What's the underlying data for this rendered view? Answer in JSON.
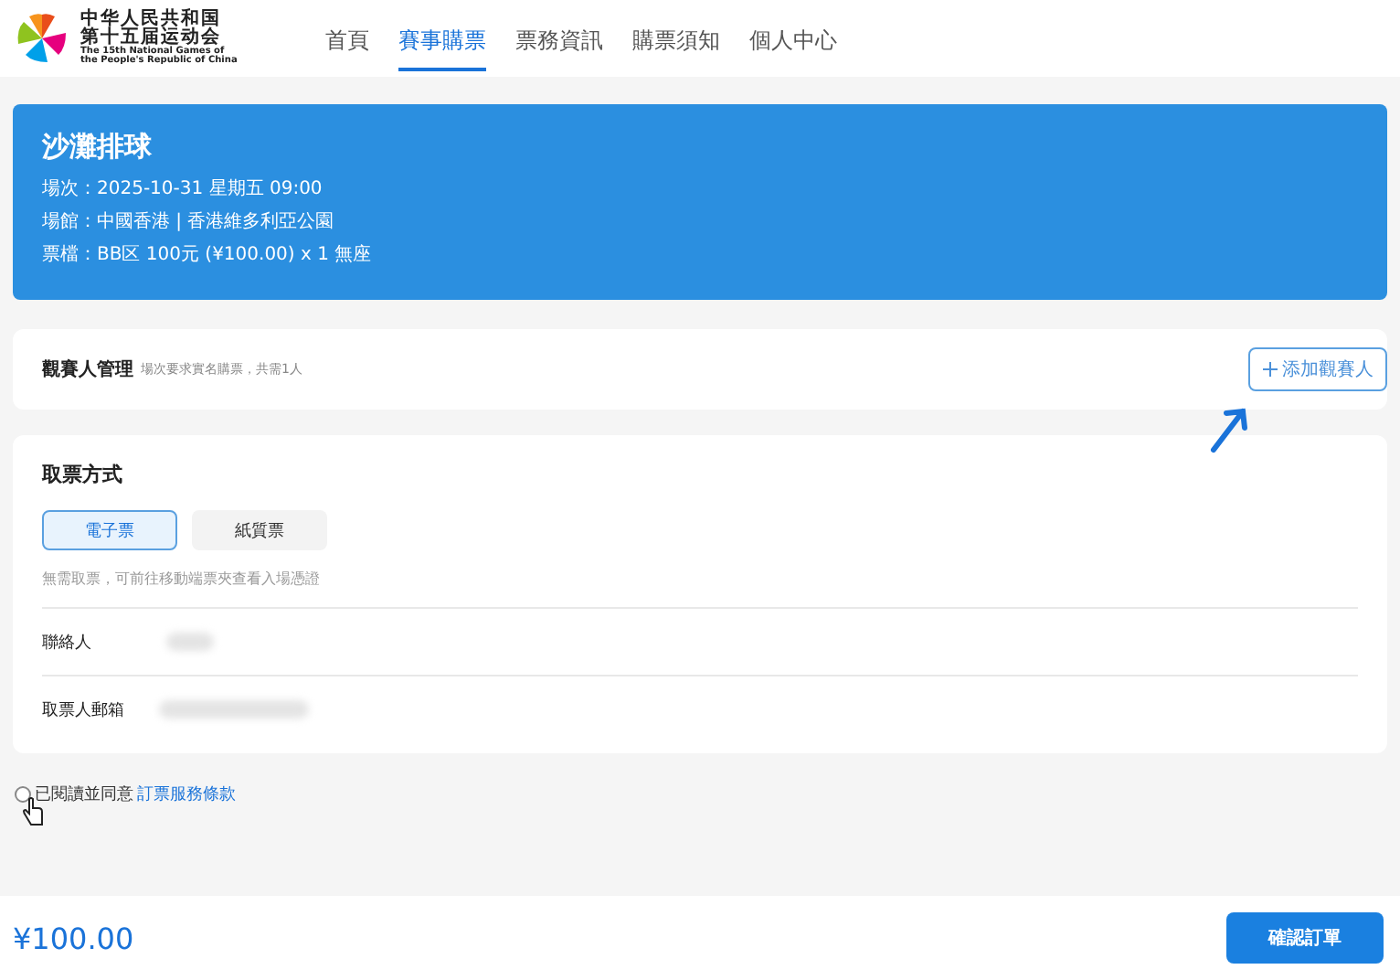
{
  "logo": {
    "title_lines": [
      "中华人民共和国",
      "第十五届运动会"
    ],
    "subtitle_lines": [
      "The 15th National Games of",
      "the People's Republic of China"
    ]
  },
  "nav": [
    {
      "label": "首頁",
      "selected": false
    },
    {
      "label": "賽事購票",
      "selected": true
    },
    {
      "label": "票務資訊",
      "selected": false
    },
    {
      "label": "購票須知",
      "selected": false
    },
    {
      "label": "個人中心",
      "selected": false
    }
  ],
  "event": {
    "title": "沙灘排球",
    "lines": [
      "場次：2025-10-31 星期五 09:00",
      "場館：中國香港 | 香港維多利亞公園",
      "票檔：BB区 100元 (¥100.00) x 1  無座"
    ]
  },
  "spectators": {
    "title": "觀賽人管理",
    "hint": "場次要求實名購票，共需1人",
    "add_button": "添加觀賽人"
  },
  "pickup": {
    "title": "取票方式",
    "options": [
      {
        "label": "電子票",
        "selected": true
      },
      {
        "label": "紙質票",
        "selected": false
      }
    ],
    "note": "無需取票，可前往移動端票夾查看入場憑證",
    "fields": [
      {
        "label": "聯絡人"
      },
      {
        "label": "取票人郵箱"
      }
    ]
  },
  "agreement": {
    "checked": false,
    "text": "已閱讀並同意",
    "link": "訂票服務條款"
  },
  "footer": {
    "total": "¥100.00",
    "confirm_button": "確認訂單"
  }
}
